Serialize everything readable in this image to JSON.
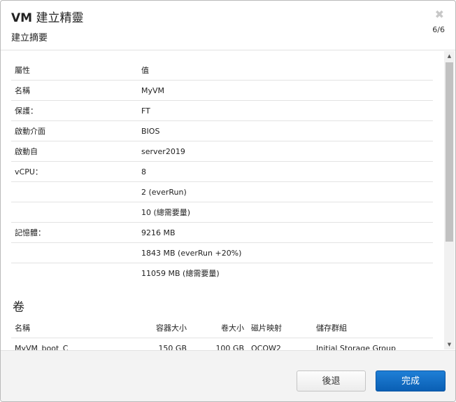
{
  "dialog": {
    "title_prefix": "VM",
    "title_rest": " 建立精靈",
    "subtitle": "建立摘要",
    "close_glyph": "✖",
    "step": "6/6"
  },
  "summary": {
    "rows": [
      {
        "label": "屬性",
        "value": "值"
      },
      {
        "label": "名稱",
        "value": "MyVM"
      },
      {
        "label": "保護：",
        "value": "FT"
      },
      {
        "label": "啟動介面",
        "value": "BIOS"
      },
      {
        "label": "啟動自",
        "value": "server2019"
      },
      {
        "label": "vCPU：",
        "value": "8"
      },
      {
        "label": "",
        "value": "2 (everRun)"
      },
      {
        "label": "",
        "value": "10 (總需要量)"
      },
      {
        "label": "記憶體：",
        "value": "9216 MB"
      },
      {
        "label": "",
        "value": "1843 MB (everRun +20%)"
      },
      {
        "label": "",
        "value": "11059 MB (總需要量)"
      }
    ]
  },
  "volumes": {
    "section_title": "卷",
    "headers": {
      "name": "名稱",
      "container_size": "容器大小",
      "volume_size": "卷大小",
      "disk_image": "磁片映射",
      "storage_group": "儲存群組"
    },
    "rows": [
      {
        "name": "MyVM_boot_C",
        "container_size": "150 GB",
        "volume_size": "100 GB",
        "disk_image": "QCOW2",
        "storage_group": "Initial Storage Group"
      }
    ]
  },
  "scrollbar": {
    "up_glyph": "▲",
    "down_glyph": "▼"
  },
  "footer": {
    "back_label": "後退",
    "finish_label": "完成"
  },
  "colors": {
    "finish_button": "#0a66c2",
    "scroll_thumb": "#c1c1c1"
  }
}
